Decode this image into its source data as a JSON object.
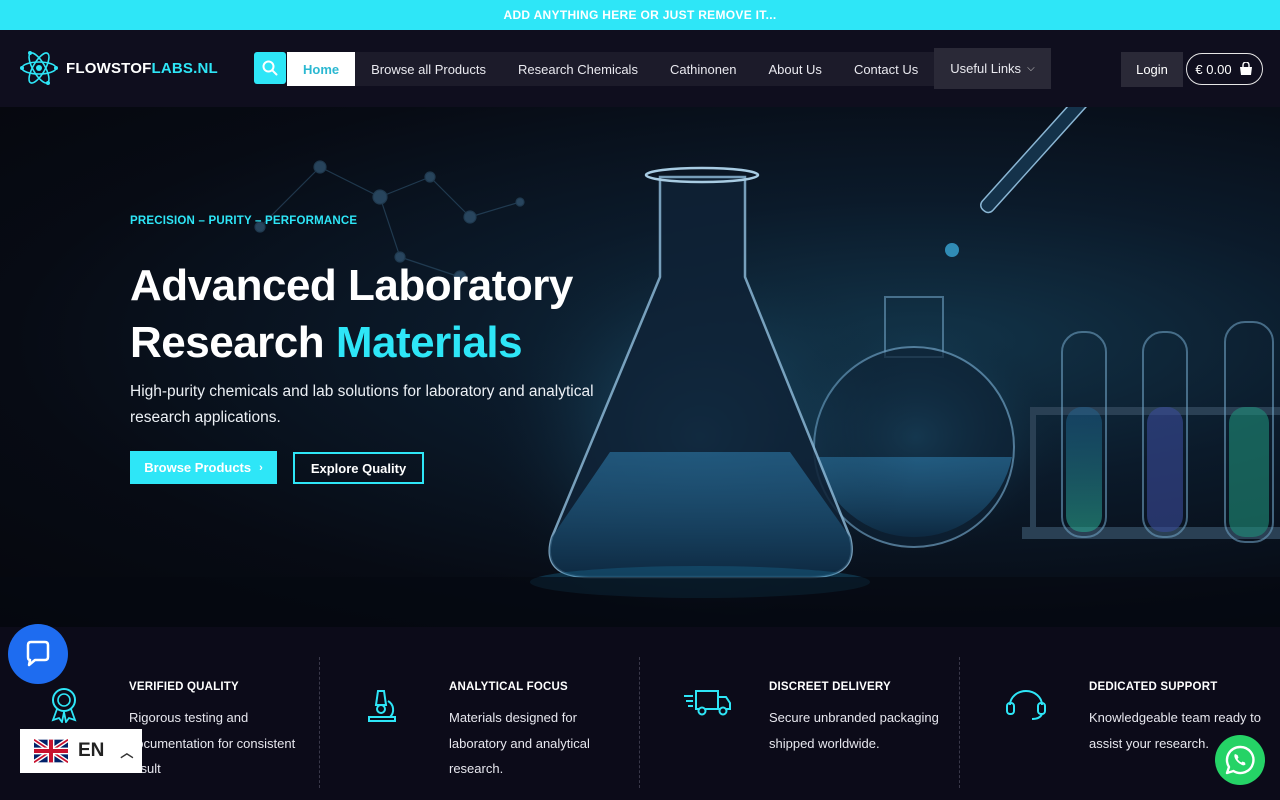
{
  "announcement": "ADD ANYTHING HERE OR JUST REMOVE IT...",
  "header": {
    "logo_main": "FLOWSTOF",
    "logo_accent": "LABS.NL",
    "search_icon": "search-icon",
    "nav": [
      "Home",
      "Browse all Products",
      "Research Chemicals",
      "Cathinonen",
      "About Us",
      "Contact Us"
    ],
    "dropdown_label": "Useful Links",
    "login_label": "Login",
    "cart_total": "€ 0.00"
  },
  "hero": {
    "eyebrow": "PRECISION – PURITY – PERFORMANCE",
    "headline_line1": "Advanced Laboratory",
    "headline_line2": "Research ",
    "headline_highlight": "Materials",
    "subtitle": "High-purity chemicals and lab solutions for laboratory and analytical research applications.",
    "primary_button": "Browse Products",
    "secondary_button": "Explore Quality"
  },
  "features": [
    {
      "icon": "award-badge-icon",
      "title": "VERIFIED QUALITY",
      "description": "Rigorous testing and documentation for consistent result"
    },
    {
      "icon": "microscope-icon",
      "title": "ANALYTICAL FOCUS",
      "description": "Materials designed for laboratory and analytical research."
    },
    {
      "icon": "delivery-truck-icon",
      "title": "DISCREET DELIVERY",
      "description": "Secure unbranded packaging shipped worldwide."
    },
    {
      "icon": "headset-icon",
      "title": "DEDICATED SUPPORT",
      "description": "Knowledgeable team ready to assist your research."
    }
  ],
  "language": {
    "code": "EN"
  },
  "colors": {
    "accent": "#2ee6f7",
    "background": "#0c0b19",
    "header": "#0f0e1e",
    "chat": "#1e6cf0",
    "whatsapp": "#25d366"
  }
}
